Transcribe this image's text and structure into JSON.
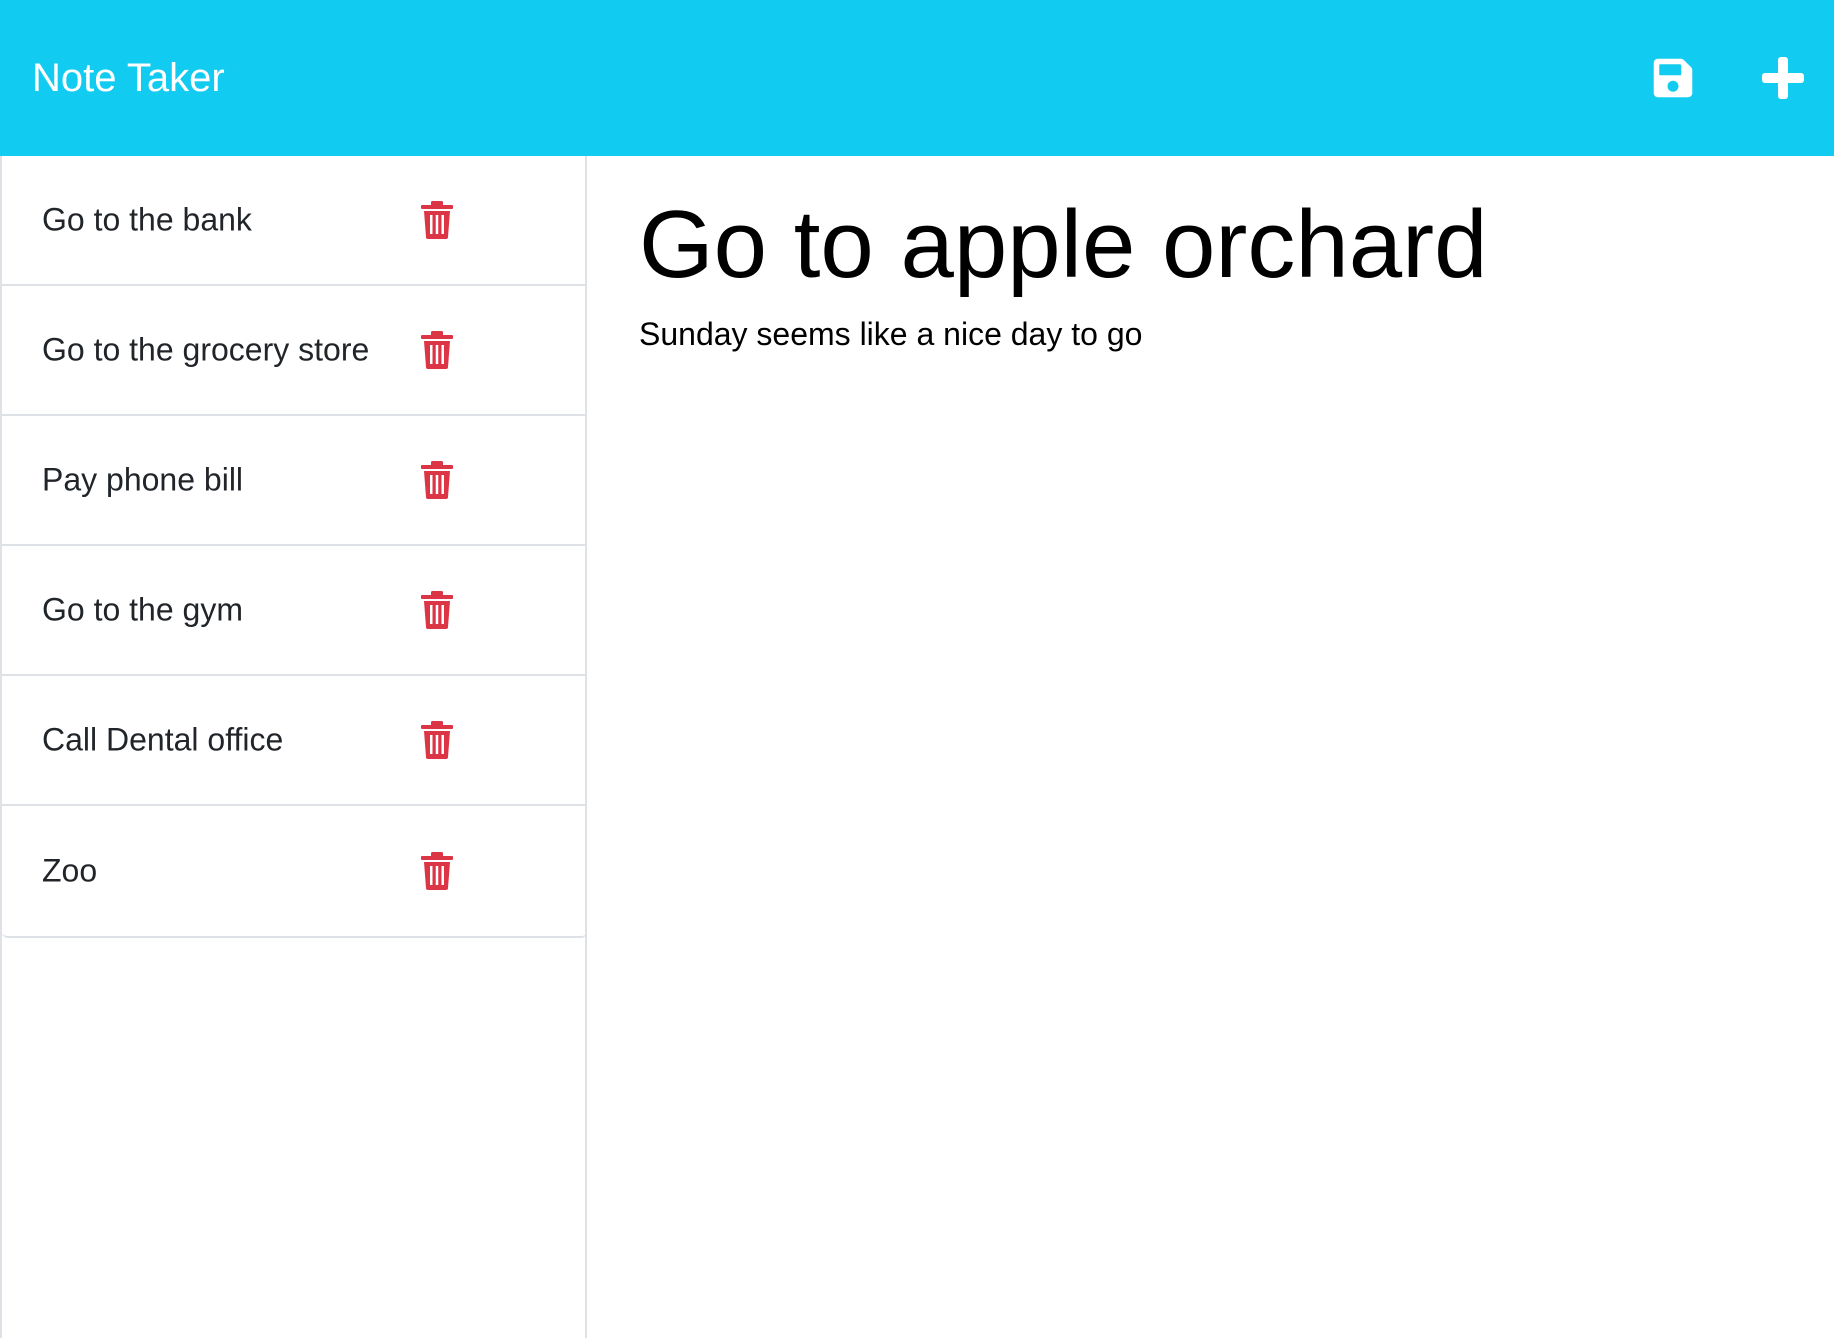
{
  "app": {
    "title": "Note Taker"
  },
  "toolbar": {
    "save_icon": "floppy-disk-icon",
    "new_icon": "plus-icon"
  },
  "sidebar": {
    "notes": [
      {
        "title": "Go to the bank",
        "delete_icon": "trash-icon"
      },
      {
        "title": "Go to the grocery store",
        "delete_icon": "trash-icon"
      },
      {
        "title": "Pay phone bill",
        "delete_icon": "trash-icon"
      },
      {
        "title": "Go to the gym",
        "delete_icon": "trash-icon"
      },
      {
        "title": "Call Dental office",
        "delete_icon": "trash-icon"
      },
      {
        "title": "Zoo",
        "delete_icon": "trash-icon"
      }
    ]
  },
  "active_note": {
    "title": "Go to apple orchard",
    "text": "Sunday seems like a nice day to go"
  },
  "colors": {
    "navbar": "#12cbf0",
    "delete": "#dc3545",
    "border": "#dee2e6"
  }
}
